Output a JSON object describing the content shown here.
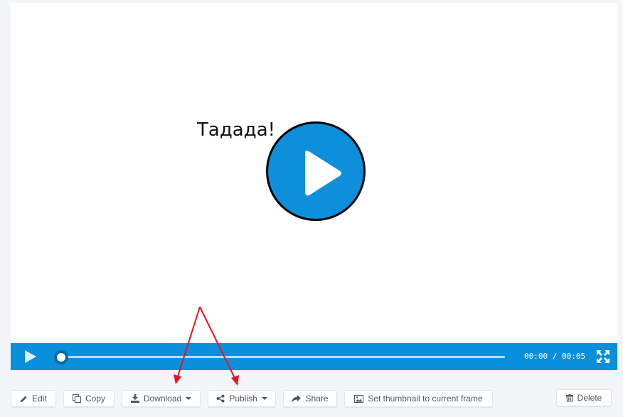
{
  "video": {
    "caption": "Тадада!",
    "time_display": "00:00 / 00:05",
    "progress_fraction": 0.0
  },
  "toolbar": {
    "edit": "Edit",
    "copy": "Copy",
    "download": "Download",
    "publish": "Publish",
    "share": "Share",
    "thumbnail": "Set thumbnail to current frame",
    "delete": "Delete"
  },
  "colors": {
    "accent": "#0a8fdc",
    "annotation_arrow": "#e8141c"
  }
}
